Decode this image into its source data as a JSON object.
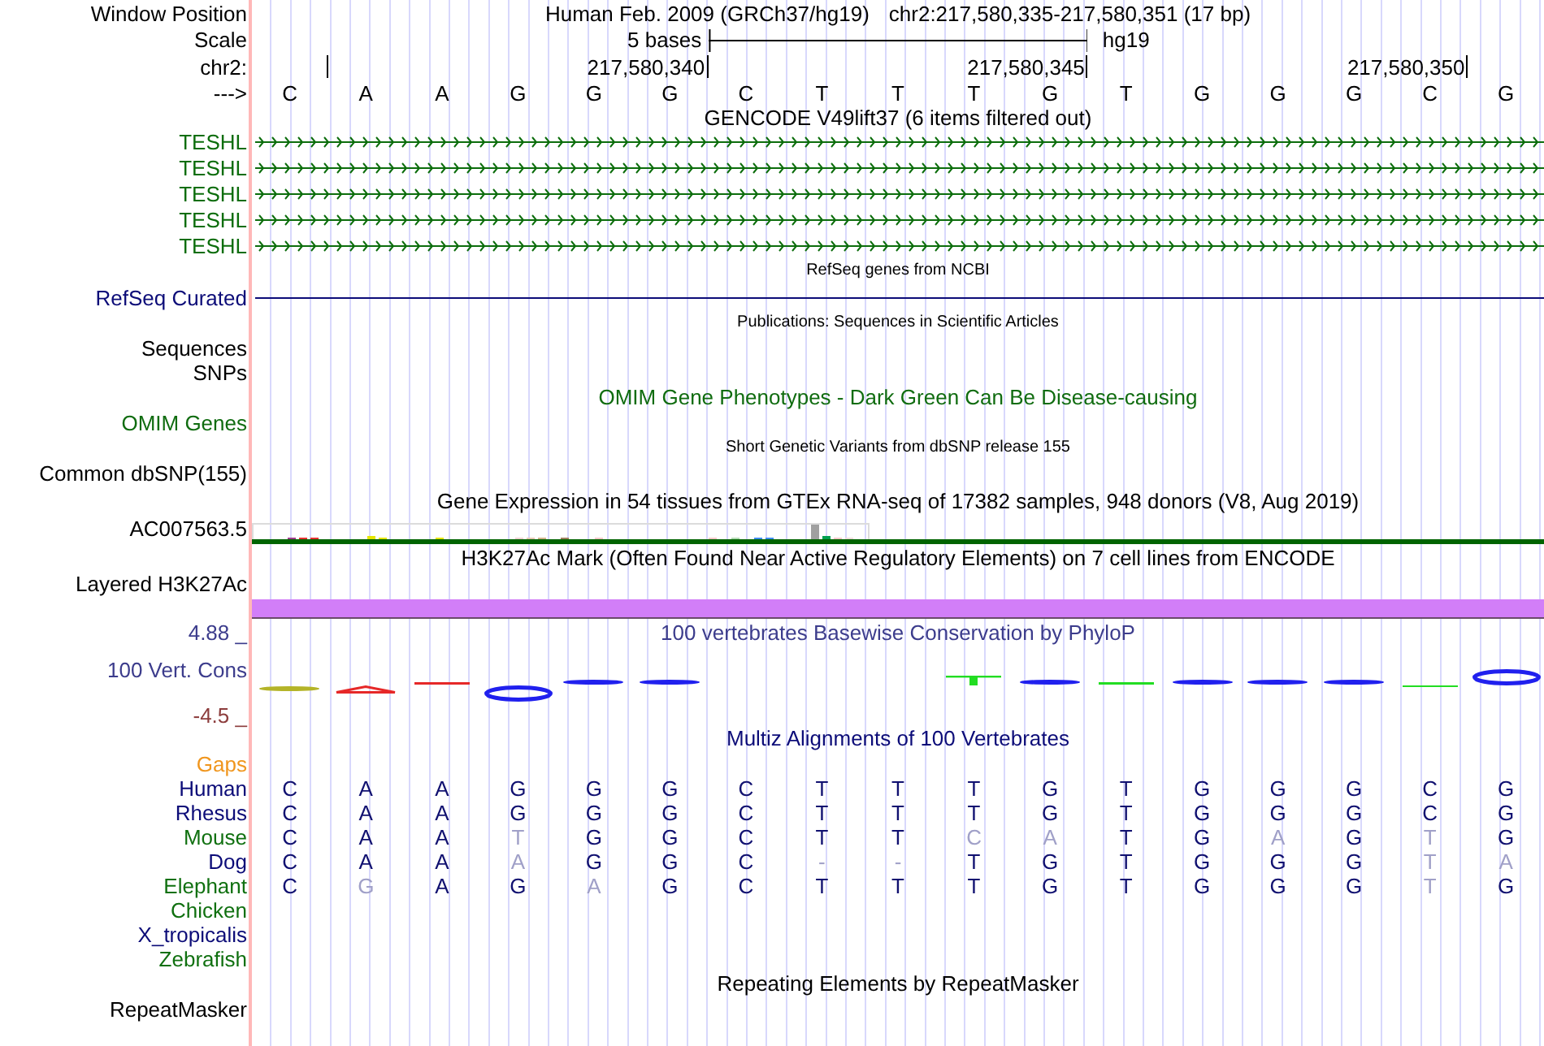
{
  "ruler": {
    "position_label": "Window Position",
    "assembly": "Human Feb. 2009 (GRCh37/hg19)",
    "position": "chr2:217,580,335-217,580,351 (17 bp)",
    "scale_label": "Scale",
    "scale_text": "5 bases",
    "scale_assembly": "hg19",
    "chrom_label": "chr2:",
    "ticks": [
      {
        "kind": "plain"
      },
      {
        "kind": "labeled",
        "label": "217,580,340"
      },
      {
        "kind": "labeled",
        "label": "217,580,345"
      },
      {
        "kind": "labeled",
        "label": "217,580,350"
      }
    ],
    "strand_label": "--->",
    "bases": [
      "C",
      "A",
      "A",
      "G",
      "G",
      "G",
      "C",
      "T",
      "T",
      "T",
      "G",
      "T",
      "G",
      "G",
      "G",
      "C",
      "G"
    ]
  },
  "tracks": [
    {
      "kind": "genes",
      "title": {
        "text": "GENCODE V49lift37 (6 items filtered out)",
        "color": "#000000",
        "small": false
      },
      "items": [
        {
          "label": "TESHL",
          "color": "#0c6d0c"
        },
        {
          "label": "TESHL",
          "color": "#0c6d0c"
        },
        {
          "label": "TESHL",
          "color": "#0c6d0c"
        },
        {
          "label": "TESHL",
          "color": "#0c6d0c"
        },
        {
          "label": "TESHL",
          "color": "#0c6d0c"
        }
      ]
    },
    {
      "kind": "line",
      "title": {
        "text": "RefSeq genes from NCBI",
        "color": "#000000",
        "small": true
      },
      "labels": [
        {
          "text": "RefSeq Curated",
          "color": "#0c0c78"
        }
      ]
    },
    {
      "kind": "plain",
      "title": {
        "text": "Publications: Sequences in Scientific Articles",
        "color": "#000000",
        "small": true
      },
      "labels": [
        {
          "text": "Sequences",
          "color": "#000000"
        },
        {
          "text": "SNPs",
          "color": "#000000"
        }
      ]
    },
    {
      "kind": "plain",
      "title": {
        "text": "OMIM Gene Phenotypes - Dark Green Can Be Disease-causing",
        "color": "#106c10",
        "small": false
      },
      "labels": [
        {
          "text": "OMIM Genes",
          "color": "#106c10"
        }
      ]
    },
    {
      "kind": "plain",
      "title": {
        "text": "Short Genetic Variants from dbSNP release 155",
        "color": "#000000",
        "small": true
      },
      "labels": [
        {
          "text": "Common dbSNP(155)",
          "color": "#000000"
        }
      ]
    },
    {
      "kind": "barchart",
      "title": {
        "text": "Gene Expression in 54 tissues from GTEx RNA-seq of 17382 samples, 948 donors (V8, Aug 2019)",
        "color": "#000000",
        "small": false
      },
      "labels": [
        {
          "text": "AC007563.5",
          "color": "#000000"
        }
      ]
    },
    {
      "kind": "signal",
      "title": {
        "text": "H3K27Ac Mark (Often Found Near Active Regulatory Elements) on 7 cell lines from ENCODE",
        "color": "#000000",
        "small": false
      },
      "labels": [
        {
          "text": "Layered H3K27Ac",
          "color": "#000000"
        }
      ]
    },
    {
      "kind": "logo",
      "title": {
        "text": "100 vertebrates Basewise Conservation by PhyloP",
        "color": "#3c3c8c",
        "small": false
      },
      "labels": [
        {
          "text": "100 Vert. Cons",
          "color": "#3c3c8c"
        }
      ],
      "scale_max": {
        "text": "4.88 _",
        "color": "#3c3c8c"
      },
      "scale_min": {
        "text": "-4.5 _",
        "color": "#8c3c3c"
      }
    },
    {
      "kind": "alignment",
      "title": {
        "text": "Multiz Alignments of 100 Vertebrates",
        "color": "#0c0c78",
        "small": false
      },
      "rows": [
        {
          "name": "Gaps",
          "color": "#f0961e"
        },
        {
          "name": "Human",
          "color": "#0c0c78",
          "bases": [
            {
              "base": "C",
              "match": true
            },
            {
              "base": "A",
              "match": true
            },
            {
              "base": "A",
              "match": true
            },
            {
              "base": "G",
              "match": true
            },
            {
              "base": "G",
              "match": true
            },
            {
              "base": "G",
              "match": true
            },
            {
              "base": "C",
              "match": true
            },
            {
              "base": "T",
              "match": true
            },
            {
              "base": "T",
              "match": true
            },
            {
              "base": "T",
              "match": true
            },
            {
              "base": "G",
              "match": true
            },
            {
              "base": "T",
              "match": true
            },
            {
              "base": "G",
              "match": true
            },
            {
              "base": "G",
              "match": true
            },
            {
              "base": "G",
              "match": true
            },
            {
              "base": "C",
              "match": true
            },
            {
              "base": "G",
              "match": true
            }
          ]
        },
        {
          "name": "Rhesus",
          "color": "#0c0c78",
          "bases": [
            {
              "base": "C",
              "match": true
            },
            {
              "base": "A",
              "match": true
            },
            {
              "base": "A",
              "match": true
            },
            {
              "base": "G",
              "match": true
            },
            {
              "base": "G",
              "match": true
            },
            {
              "base": "G",
              "match": true
            },
            {
              "base": "C",
              "match": true
            },
            {
              "base": "T",
              "match": true
            },
            {
              "base": "T",
              "match": true
            },
            {
              "base": "T",
              "match": true
            },
            {
              "base": "G",
              "match": true
            },
            {
              "base": "T",
              "match": true
            },
            {
              "base": "G",
              "match": true
            },
            {
              "base": "G",
              "match": true
            },
            {
              "base": "G",
              "match": true
            },
            {
              "base": "C",
              "match": true
            },
            {
              "base": "G",
              "match": true
            }
          ]
        },
        {
          "name": "Mouse",
          "color": "#107010",
          "bases": [
            {
              "base": "C",
              "match": true
            },
            {
              "base": "A",
              "match": true
            },
            {
              "base": "A",
              "match": true
            },
            {
              "base": "T",
              "match": false
            },
            {
              "base": "G",
              "match": true
            },
            {
              "base": "G",
              "match": true
            },
            {
              "base": "C",
              "match": true
            },
            {
              "base": "T",
              "match": true
            },
            {
              "base": "T",
              "match": true
            },
            {
              "base": "C",
              "match": false
            },
            {
              "base": "A",
              "match": false
            },
            {
              "base": "T",
              "match": true
            },
            {
              "base": "G",
              "match": true
            },
            {
              "base": "A",
              "match": false
            },
            {
              "base": "G",
              "match": true
            },
            {
              "base": "T",
              "match": false
            },
            {
              "base": "G",
              "match": true
            }
          ]
        },
        {
          "name": "Dog",
          "color": "#0c0c78",
          "bases": [
            {
              "base": "C",
              "match": true
            },
            {
              "base": "A",
              "match": true
            },
            {
              "base": "A",
              "match": true
            },
            {
              "base": "A",
              "match": false
            },
            {
              "base": "G",
              "match": true
            },
            {
              "base": "G",
              "match": true
            },
            {
              "base": "C",
              "match": true
            },
            {
              "base": "-",
              "match": false
            },
            {
              "base": "-",
              "match": false
            },
            {
              "base": "T",
              "match": true
            },
            {
              "base": "G",
              "match": true
            },
            {
              "base": "T",
              "match": true
            },
            {
              "base": "G",
              "match": true
            },
            {
              "base": "G",
              "match": true
            },
            {
              "base": "G",
              "match": true
            },
            {
              "base": "T",
              "match": false
            },
            {
              "base": "A",
              "match": false
            }
          ]
        },
        {
          "name": "Elephant",
          "color": "#107010",
          "bases": [
            {
              "base": "C",
              "match": true
            },
            {
              "base": "G",
              "match": false
            },
            {
              "base": "A",
              "match": true
            },
            {
              "base": "G",
              "match": true
            },
            {
              "base": "A",
              "match": false
            },
            {
              "base": "G",
              "match": true
            },
            {
              "base": "C",
              "match": true
            },
            {
              "base": "T",
              "match": true
            },
            {
              "base": "T",
              "match": true
            },
            {
              "base": "T",
              "match": true
            },
            {
              "base": "G",
              "match": true
            },
            {
              "base": "T",
              "match": true
            },
            {
              "base": "G",
              "match": true
            },
            {
              "base": "G",
              "match": true
            },
            {
              "base": "G",
              "match": true
            },
            {
              "base": "T",
              "match": false
            },
            {
              "base": "G",
              "match": true
            }
          ]
        },
        {
          "name": "Chicken",
          "color": "#107010"
        },
        {
          "name": "X_tropicalis",
          "color": "#0c0c78"
        },
        {
          "name": "Zebrafish",
          "color": "#107010"
        }
      ]
    },
    {
      "kind": "plain",
      "title": {
        "text": "Repeating Elements by RepeatMasker",
        "color": "#000000",
        "small": false
      },
      "labels": [
        {
          "text": "RepeatMasker",
          "color": "#000000"
        }
      ]
    }
  ]
}
